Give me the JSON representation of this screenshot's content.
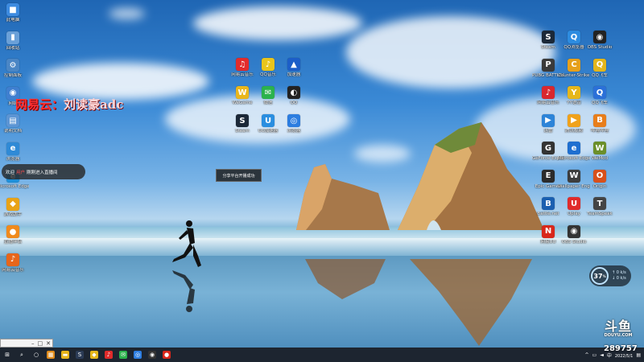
{
  "desktop_icons_left": [
    {
      "label": "此电脑",
      "color": "#3d8be0",
      "glyph": "■"
    },
    {
      "label": "回收站",
      "color": "#6aa0d8",
      "glyph": "▮"
    },
    {
      "label": "控制面板",
      "color": "#4a86c5",
      "glyph": "⚙"
    },
    {
      "label": "网络",
      "color": "#3f7fd0",
      "glyph": "◉"
    },
    {
      "label": "说明文档",
      "color": "#5c95d4",
      "glyph": "▤"
    },
    {
      "label": "浏览器",
      "color": "#2f8ad6",
      "glyph": "e"
    },
    {
      "label": "Microsoft Edge",
      "color": "#1e8fd8",
      "glyph": "e"
    },
    {
      "label": "游戏助手",
      "color": "#e8a317",
      "glyph": "◆"
    },
    {
      "label": "直播伴侣",
      "color": "#f08a1c",
      "glyph": "●"
    },
    {
      "label": "网易云音乐",
      "color": "#e7661b",
      "glyph": "♪"
    }
  ],
  "desktop_icons_mid": [
    {
      "label": "网易云音乐",
      "color": "#e22b2b",
      "glyph": "♫"
    },
    {
      "label": "QQ音乐",
      "color": "#e9c51b",
      "glyph": "♪"
    },
    {
      "label": "加速器",
      "color": "#1c5ec8",
      "glyph": "▲"
    },
    {
      "label": "WeGame",
      "color": "#e9b61b",
      "glyph": "W"
    },
    {
      "label": "微信",
      "color": "#2bb24c",
      "glyph": "✉"
    },
    {
      "label": "QQ",
      "color": "#222222",
      "glyph": "◐"
    },
    {
      "label": "Steam",
      "color": "#1b2838",
      "glyph": "S"
    },
    {
      "label": "UU加速器",
      "color": "#2a8ee0",
      "glyph": "U"
    },
    {
      "label": "浏览器",
      "color": "#2c7de0",
      "glyph": "◎"
    }
  ],
  "desktop_icons_right": [
    {
      "label": "Steam",
      "color": "#1b2838",
      "glyph": "S"
    },
    {
      "label": "QQ浏览器",
      "color": "#2d8ce0",
      "glyph": "Q"
    },
    {
      "label": "OBS Studio",
      "color": "#222222",
      "glyph": "◉"
    },
    {
      "label": "PUBG BATTLEGR...",
      "color": "#3a3a3a",
      "glyph": "P"
    },
    {
      "label": "Counter-Strike Global Off...",
      "color": "#e6a01b",
      "glyph": "C"
    },
    {
      "label": "QQ飞车",
      "color": "#e3b61b",
      "glyph": "Q"
    },
    {
      "label": "网易云音乐",
      "color": "#d9272e",
      "glyph": "♪"
    },
    {
      "label": "YY语音",
      "color": "#e6b71b",
      "glyph": "Y"
    },
    {
      "label": "QQ飞车",
      "color": "#2b70d8",
      "glyph": "Q"
    },
    {
      "label": "迅雷",
      "color": "#2d84d8",
      "glyph": "▶"
    },
    {
      "label": "腾讯视频",
      "color": "#f0a21b",
      "glyph": "▶"
    },
    {
      "label": "哔哩哔哩",
      "color": "#e87e1b",
      "glyph": "B"
    },
    {
      "label": "GeForce Experience",
      "color": "#333333",
      "glyph": "G"
    },
    {
      "label": "Microsoft Edge",
      "color": "#1e6fd0",
      "glyph": "e"
    },
    {
      "label": "WeMod",
      "color": "#6b8f2a",
      "glyph": "W"
    },
    {
      "label": "Epic Games",
      "color": "#2b2b2b",
      "glyph": "E"
    },
    {
      "label": "Wallpaper Engine",
      "color": "#3d3d3d",
      "glyph": "W"
    },
    {
      "label": "Origin",
      "color": "#d8501b",
      "glyph": "O"
    },
    {
      "label": "Battle.net",
      "color": "#1a5fb0",
      "glyph": "B"
    },
    {
      "label": "Uplay",
      "color": "#e02b2b",
      "glyph": "U"
    },
    {
      "label": "TeamSpeak",
      "color": "#444444",
      "glyph": "T"
    },
    {
      "label": "网易UU",
      "color": "#d8271b",
      "glyph": "N"
    },
    {
      "label": "OBS Studio",
      "color": "#333333",
      "glyph": "◉"
    }
  ],
  "watermark": {
    "prefix": "网易云：",
    "name": "刘读豪adc"
  },
  "welcome": {
    "before": "欢迎",
    "user": "用户",
    "after": "刚刚进入直播间"
  },
  "toast": "分享平台开播成功",
  "cpu_widget": {
    "value": "37",
    "unit": "%",
    "up": "0 k/s",
    "down": "0 k/s"
  },
  "douyu": {
    "logo": "斗鱼",
    "sub": "DOUYU.COM"
  },
  "room_id": "289757",
  "taskbar": {
    "icons": [
      {
        "name": "windows-start",
        "color": "#ffffff",
        "glyph": "⊞"
      },
      {
        "name": "search",
        "color": "#ffffff",
        "glyph": "⌕"
      },
      {
        "name": "task-view",
        "color": "#ffffff",
        "glyph": "○"
      },
      {
        "name": "app-orange",
        "color": "#e08b1b",
        "glyph": "▦"
      },
      {
        "name": "file-explorer",
        "color": "#e8b41b",
        "glyph": "▬"
      },
      {
        "name": "steam",
        "color": "#2b3b55",
        "glyph": "S"
      },
      {
        "name": "app-yellow",
        "color": "#e6b71b",
        "glyph": "◆"
      },
      {
        "name": "netease-music",
        "color": "#e02b2b",
        "glyph": "♪"
      },
      {
        "name": "wechat",
        "color": "#2bb24c",
        "glyph": "✉"
      },
      {
        "name": "browser",
        "color": "#2d7de0",
        "glyph": "◎"
      },
      {
        "name": "obs",
        "color": "#333333",
        "glyph": "◉"
      },
      {
        "name": "app-red",
        "color": "#d8271b",
        "glyph": "●"
      }
    ],
    "date": "2022/5/1"
  }
}
